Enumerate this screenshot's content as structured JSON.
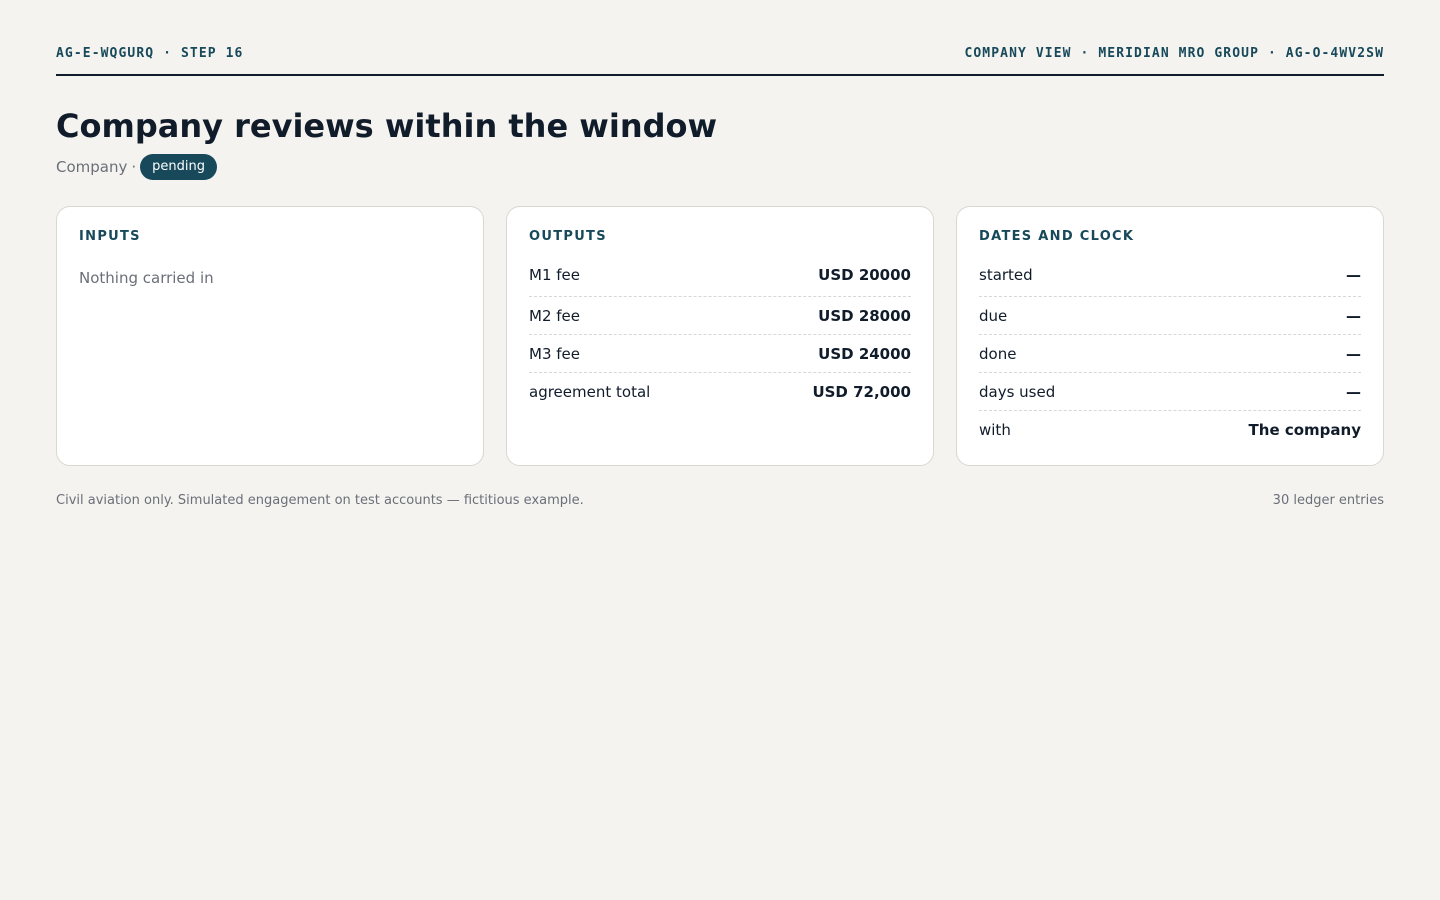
{
  "header": {
    "left": "AG-E-WQGURQ · STEP 16",
    "right": "COMPANY VIEW · MERIDIAN MRO GROUP · AG-O-4WV2SW"
  },
  "title": "Company reviews within the window",
  "subtitle": {
    "party": "Company",
    "separator": "·",
    "status": "pending"
  },
  "inputs": {
    "heading": "INPUTS",
    "empty_text": "Nothing carried in"
  },
  "outputs": {
    "heading": "OUTPUTS",
    "rows": [
      {
        "label": "M1 fee",
        "value": "USD 20000"
      },
      {
        "label": "M2 fee",
        "value": "USD 28000"
      },
      {
        "label": "M3 fee",
        "value": "USD 24000"
      },
      {
        "label": "agreement total",
        "value": "USD 72,000"
      }
    ]
  },
  "dates": {
    "heading": "DATES AND CLOCK",
    "rows": [
      {
        "label": "started",
        "value": "—"
      },
      {
        "label": "due",
        "value": "—"
      },
      {
        "label": "done",
        "value": "—"
      },
      {
        "label": "days used",
        "value": "—"
      },
      {
        "label": "with",
        "value": "The company"
      }
    ]
  },
  "footer": {
    "note": "Civil aviation only. Simulated engagement on test accounts — fictitious example.",
    "ledger_count": "30 ledger entries"
  },
  "colors": {
    "background": "#f4f3ef",
    "accent": "#17495a",
    "text": "#111c2b",
    "muted": "#6b6f78"
  }
}
